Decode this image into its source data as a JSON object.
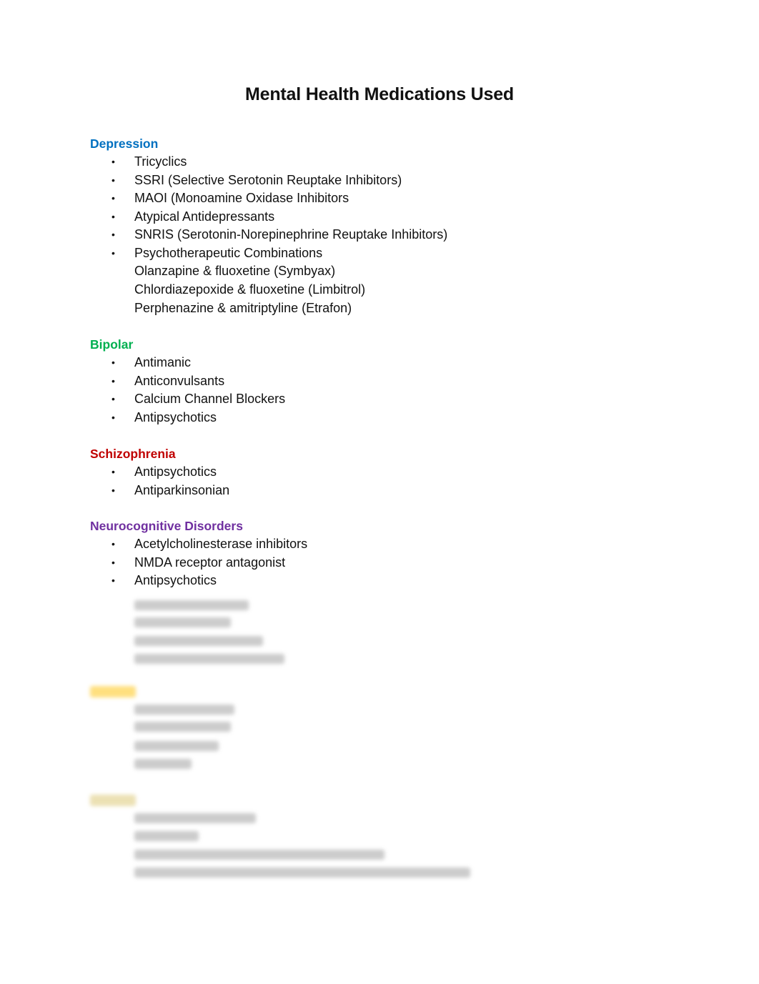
{
  "document": {
    "title": "Mental Health Medications Used",
    "sections": [
      {
        "heading": "Depression",
        "color": "#0070C0",
        "items": [
          "Tricyclics",
          "SSRI (Selective Serotonin Reuptake Inhibitors)",
          "MAOI (Monoamine Oxidase Inhibitors",
          "Atypical Antidepressants",
          "SNRIS (Serotonin-Norepinephrine Reuptake Inhibitors)",
          "Psychotherapeutic Combinations"
        ],
        "sub_items": [
          "Olanzapine & fluoxetine (Symbyax)",
          "Chlordiazepoxide & fluoxetine (Limbitrol)",
          "Perphenazine & amitriptyline (Etrafon)"
        ]
      },
      {
        "heading": "Bipolar",
        "color": "#00B050",
        "items": [
          "Antimanic",
          "Anticonvulsants",
          "Calcium Channel Blockers",
          "Antipsychotics"
        ]
      },
      {
        "heading": "Schizophrenia",
        "color": "#C00000",
        "items": [
          "Antipsychotics",
          "Antiparkinsonian"
        ]
      },
      {
        "heading": "Neurocognitive Disorders",
        "color": "#7030A0",
        "items": [
          "Acetylcholinesterase inhibitors",
          "NMDA receptor antagonist",
          "Antipsychotics"
        ]
      }
    ],
    "blurred_section_colors": [
      "#FFC000",
      "#D9C36A"
    ],
    "bullet_glyph": "•"
  }
}
